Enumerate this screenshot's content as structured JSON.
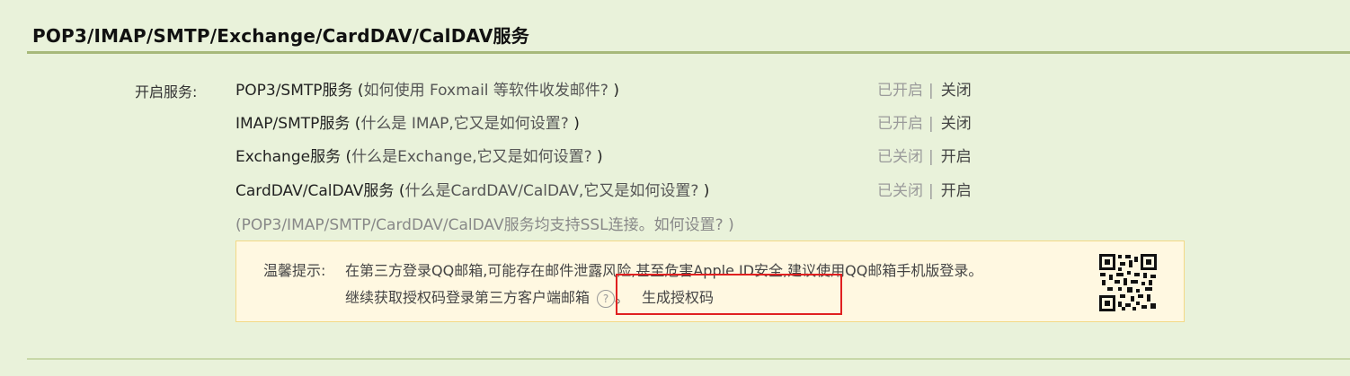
{
  "section": {
    "title": "POP3/IMAP/SMTP/Exchange/CardDAV/CalDAV服务"
  },
  "services": {
    "label": "开启服务:",
    "rows": [
      {
        "name": "POP3/SMTP服务",
        "open_paren": " (",
        "help": "如何使用 Foxmail 等软件收发邮件?",
        "close_paren": " )",
        "state": "已开启",
        "separator": "|",
        "action": "关闭"
      },
      {
        "name": "IMAP/SMTP服务",
        "open_paren": " (",
        "help": "什么是 IMAP,它又是如何设置?",
        "close_paren": " )",
        "state": "已开启",
        "separator": "|",
        "action": "关闭"
      },
      {
        "name": "Exchange服务",
        "open_paren": " (",
        "help": "什么是Exchange,它又是如何设置?",
        "close_paren": " )",
        "state": "已关闭",
        "separator": "|",
        "action": "开启"
      },
      {
        "name": "CardDAV/CalDAV服务",
        "open_paren": " (",
        "help": "什么是CardDAV/CalDAV,它又是如何设置?",
        "close_paren": " )",
        "state": "已关闭",
        "separator": "|",
        "action": "开启"
      }
    ],
    "ssl_note_prefix": "(POP3/IMAP/SMTP/CardDAV/CalDAV服务均支持SSL连接。",
    "ssl_note_link": "如何设置?",
    "ssl_note_suffix": " )"
  },
  "tip": {
    "label": "温馨提示:",
    "line1_prefix": "在第三方登录QQ邮箱,可能存在邮件泄露风险,甚至危害Apple ID安全,建议使用",
    "line1_link": "QQ邮箱手机版",
    "line1_suffix": "登录。",
    "line2_text": "继续获取授权码登录第三方客户端邮箱",
    "help_glyph": "?",
    "line2_punct": "。",
    "generate_link": "生成授权码"
  },
  "icons": {
    "help": "question-circle-icon",
    "qr": "qr-code-icon"
  },
  "colors": {
    "page_bg": "#e9f2da",
    "tip_bg": "#fff8e1",
    "tip_border": "#f3d987",
    "highlight": "#e02020",
    "rule": "#a7b97a"
  }
}
